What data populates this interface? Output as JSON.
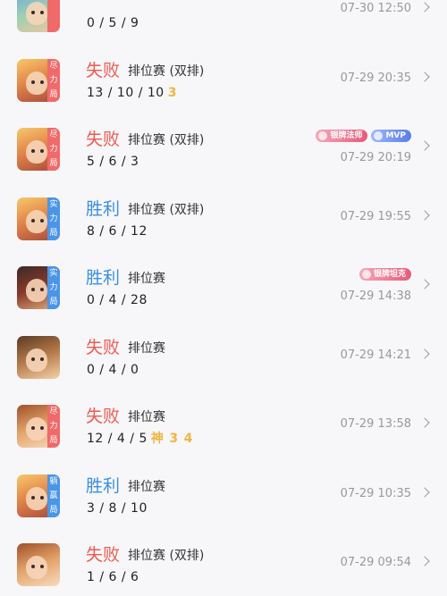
{
  "matches": [
    {
      "result": "",
      "result_class": "lose",
      "mode": [
        "",
        "",
        ""
      ],
      "mode_class": "lose",
      "match_type": "",
      "kda": "0 / 5 / 9",
      "extras": [],
      "honors": [],
      "time": "07-30 12:50",
      "avatar": "h5"
    },
    {
      "result": "失败",
      "result_class": "lose",
      "mode": [
        "尽",
        "力",
        "局"
      ],
      "mode_class": "lose",
      "match_type": "排位赛 (双排)",
      "kda": "13 / 10 / 10",
      "extras": [
        {
          "text": "3",
          "cls": "badge3"
        }
      ],
      "honors": [],
      "time": "07-29 20:35",
      "avatar": "h1"
    },
    {
      "result": "失败",
      "result_class": "lose",
      "mode": [
        "尽",
        "力",
        "局"
      ],
      "mode_class": "lose",
      "match_type": "排位赛 (双排)",
      "kda": "5 / 6 / 3",
      "extras": [],
      "honors": [
        {
          "text": "银牌法师",
          "cls": "silver"
        },
        {
          "text": "MVP",
          "cls": "mvp"
        }
      ],
      "time": "07-29 20:19",
      "avatar": "h1"
    },
    {
      "result": "胜利",
      "result_class": "win",
      "mode": [
        "实",
        "力",
        "局"
      ],
      "mode_class": "win",
      "match_type": "排位赛 (双排)",
      "kda": "8 / 6 / 12",
      "extras": [],
      "honors": [],
      "time": "07-29 19:55",
      "avatar": "h1"
    },
    {
      "result": "胜利",
      "result_class": "win",
      "mode": [
        "实",
        "力",
        "局"
      ],
      "mode_class": "win",
      "match_type": "排位赛",
      "kda": "0 / 4 / 28",
      "extras": [],
      "honors": [
        {
          "text": "银牌坦克",
          "cls": "silver"
        }
      ],
      "time": "07-29 14:38",
      "avatar": "h2"
    },
    {
      "result": "失败",
      "result_class": "lose",
      "mode": [],
      "mode_class": "",
      "match_type": "排位赛",
      "kda": "0 / 4 / 0",
      "extras": [],
      "honors": [],
      "time": "07-29 14:21",
      "avatar": "h3"
    },
    {
      "result": "失败",
      "result_class": "lose",
      "mode": [
        "尽",
        "力",
        "局"
      ],
      "mode_class": "lose",
      "match_type": "排位赛",
      "kda": "12 / 4 / 5",
      "extras": [
        {
          "text": "神",
          "cls": "badge3"
        },
        {
          "text": "3",
          "cls": "badge3"
        },
        {
          "text": "4",
          "cls": "badge3"
        }
      ],
      "honors": [],
      "time": "07-29 13:58",
      "avatar": "h4"
    },
    {
      "result": "胜利",
      "result_class": "win",
      "mode": [
        "躺",
        "赢",
        "局"
      ],
      "mode_class": "win",
      "match_type": "排位赛",
      "kda": "3 / 8 / 10",
      "extras": [],
      "honors": [],
      "time": "07-29 10:35",
      "avatar": "h1"
    },
    {
      "result": "失败",
      "result_class": "lose",
      "mode": [],
      "mode_class": "",
      "match_type": "排位赛 (双排)",
      "kda": "1 / 6 / 6",
      "extras": [],
      "honors": [],
      "time": "07-29 09:54",
      "avatar": "h4"
    }
  ]
}
